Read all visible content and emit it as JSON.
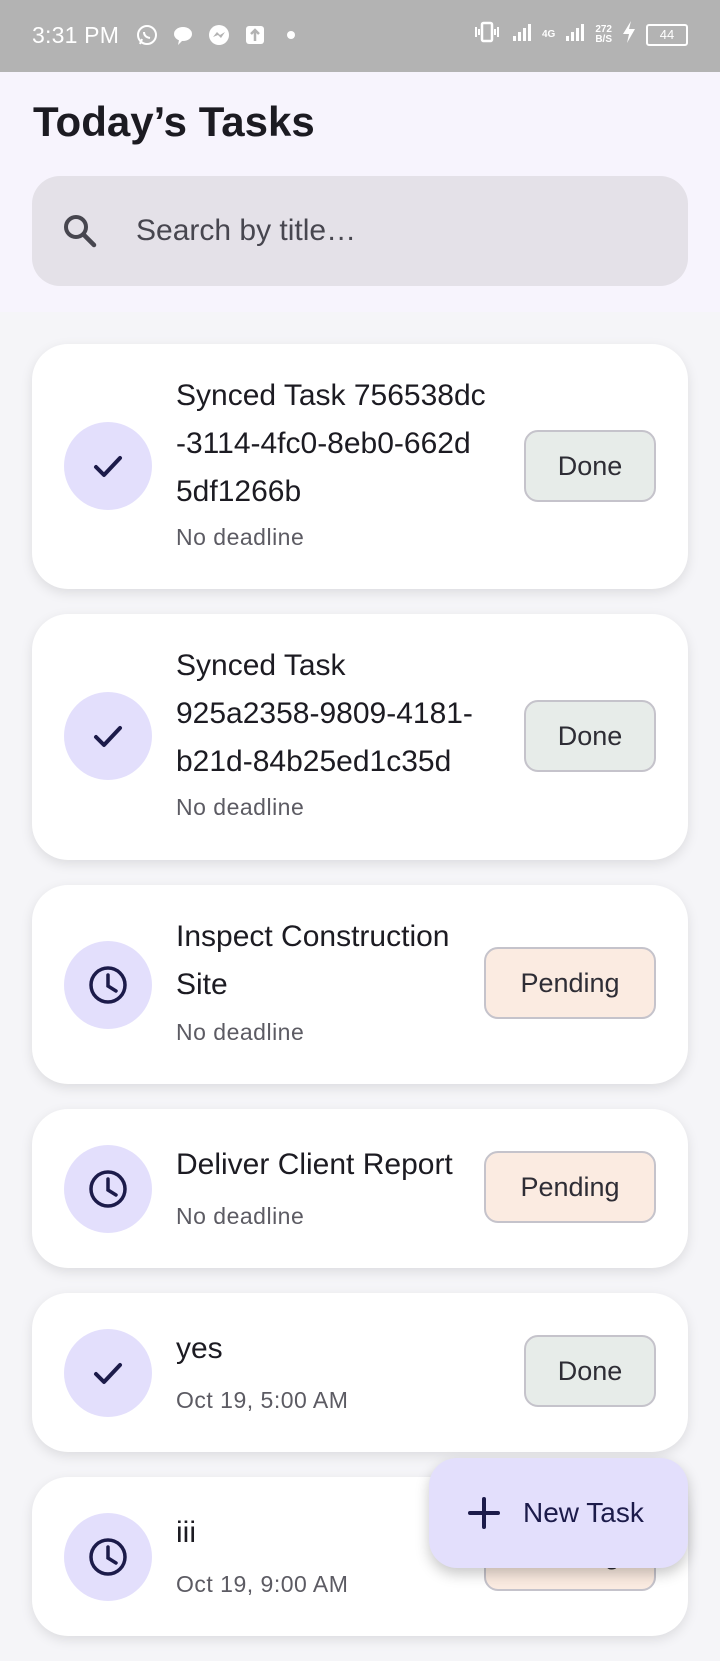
{
  "status_bar": {
    "time": "3:31 PM",
    "network_type": "4G",
    "net_speed_value": "272",
    "net_speed_unit": "B/S",
    "battery_level": "44"
  },
  "header": {
    "title": "Today’s Tasks"
  },
  "search": {
    "placeholder": "Search by title…"
  },
  "tasks": [
    {
      "title_lines": [
        "Synced Task 756538dc",
        "-3114-4fc0-8eb0-662d",
        "5df1266b"
      ],
      "deadline": "No deadline",
      "status": "Done",
      "icon": "check-icon"
    },
    {
      "title_lines": [
        "Synced Task",
        "925a2358-9809-4181-",
        "b21d-84b25ed1c35d"
      ],
      "deadline": "No deadline",
      "status": "Done",
      "icon": "check-icon"
    },
    {
      "title_lines": [
        "Inspect Construction",
        "Site"
      ],
      "deadline": "No deadline",
      "status": "Pending",
      "icon": "clock-icon"
    },
    {
      "title_lines": [
        "Deliver Client Report"
      ],
      "deadline": "No deadline",
      "status": "Pending",
      "icon": "clock-icon"
    },
    {
      "title_lines": [
        "yes"
      ],
      "deadline": "Oct 19, 5:00 AM",
      "status": "Done",
      "icon": "check-icon"
    },
    {
      "title_lines": [
        "iii"
      ],
      "deadline": "Oct 19, 9:00 AM",
      "status": "Pending",
      "icon": "clock-icon"
    }
  ],
  "fab": {
    "label": "New Task",
    "icon": "plus-icon"
  },
  "colors": {
    "accent_container": "#e3dffc",
    "done_chip": "#e7ece9",
    "pending_chip": "#fbebe1",
    "status_bar": "#b3b3b3"
  }
}
